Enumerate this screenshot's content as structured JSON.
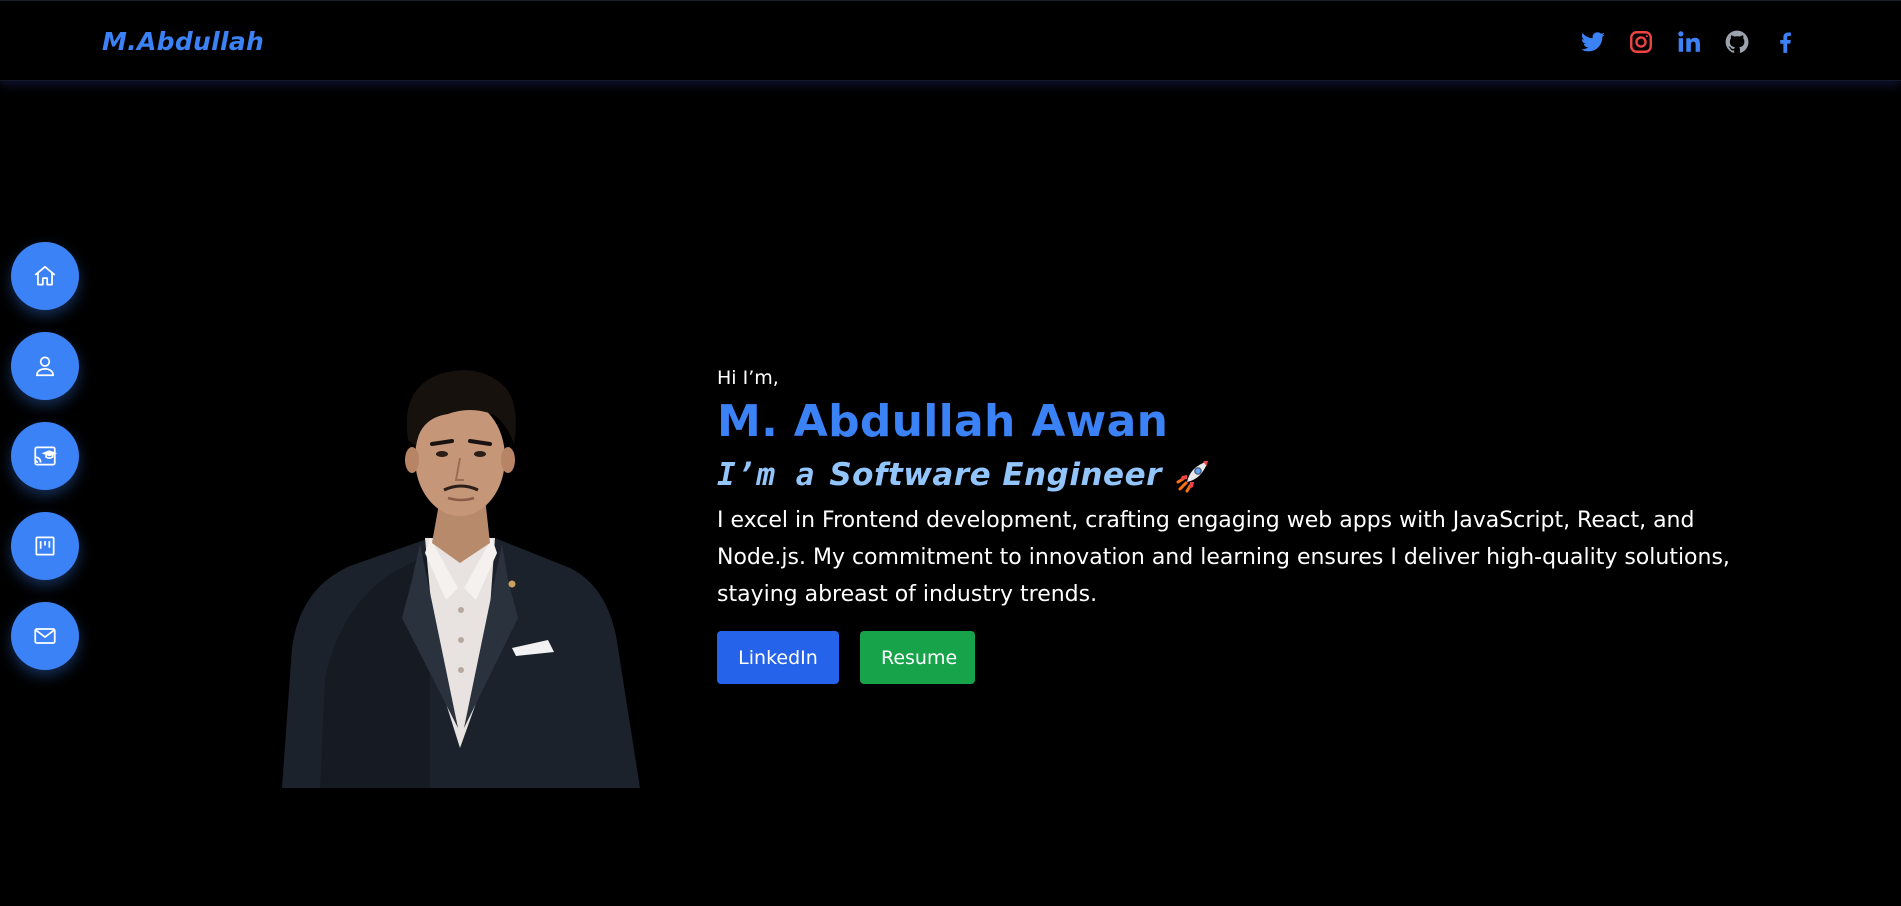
{
  "header": {
    "brand": "M.Abdullah",
    "socials": [
      {
        "icon": "twitter-icon",
        "color": "#3b82f6"
      },
      {
        "icon": "instagram-icon",
        "color": "#ef4444"
      },
      {
        "icon": "linkedin-icon",
        "color": "#3b82f6"
      },
      {
        "icon": "github-icon",
        "color": "#9ca3af"
      },
      {
        "icon": "facebook-icon",
        "color": "#3b82f6"
      }
    ]
  },
  "sidenav": {
    "items": [
      {
        "icon": "home-icon"
      },
      {
        "icon": "user-icon"
      },
      {
        "icon": "education-icon"
      },
      {
        "icon": "projects-icon"
      },
      {
        "icon": "mail-icon"
      }
    ],
    "color": "#3b82f6"
  },
  "hero": {
    "greeting": "Hi I’m,",
    "name": "M. Abdullah Awan",
    "role_prefix": "I’m a",
    "role": "Software Engineer",
    "role_icon": "rocket-icon",
    "description": "I excel in Frontend development, crafting engaging web apps with JavaScript, React, and Node.js. My commitment to innovation and learning ensures I deliver high-quality solutions, staying abreast of industry trends.",
    "buttons": {
      "linkedin": "LinkedIn",
      "resume": "Resume"
    }
  },
  "colors": {
    "accent": "#3b82f6",
    "role": "#93c5fd",
    "linkedin_button": "#2563eb",
    "resume_button": "#16a34a",
    "background": "#000000"
  }
}
